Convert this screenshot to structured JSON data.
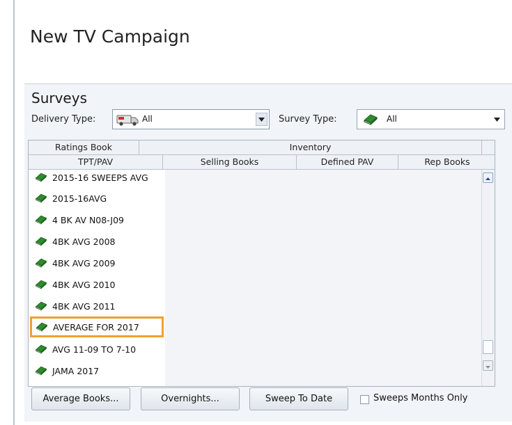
{
  "window": {
    "title": "New TV Campaign"
  },
  "surveys": {
    "section_title": "Surveys",
    "delivery_type": {
      "label": "Delivery Type:",
      "value": "All"
    },
    "survey_type": {
      "label": "Survey Type:",
      "value": "All"
    }
  },
  "grid": {
    "group_headers": [
      "Ratings Book",
      "Inventory"
    ],
    "columns": [
      "TPT/PAV",
      "Selling Books",
      "Defined PAV",
      "Rep Books"
    ],
    "rows": [
      "2015-16 SWEEPS AVG",
      "2015-16AVG",
      "4 BK AV N08-J09",
      "4BK AVG 2008",
      "4BK AVG 2009",
      "4BK AVG 2010",
      "4BK AVG 2011",
      "AVERAGE FOR 2017",
      "AVG 11-09 TO 7-10",
      "JAMA 2017"
    ],
    "selected_row": "AVERAGE FOR 2017"
  },
  "buttons": {
    "average_books": "Average Books...",
    "overnights": "Overnights...",
    "sweep_to_date": "Sweep To Date"
  },
  "checkbox": {
    "label": "Sweeps Months Only",
    "checked": false
  },
  "colors": {
    "highlight": "#f0a030",
    "book_icon": "#2e8b2e"
  }
}
